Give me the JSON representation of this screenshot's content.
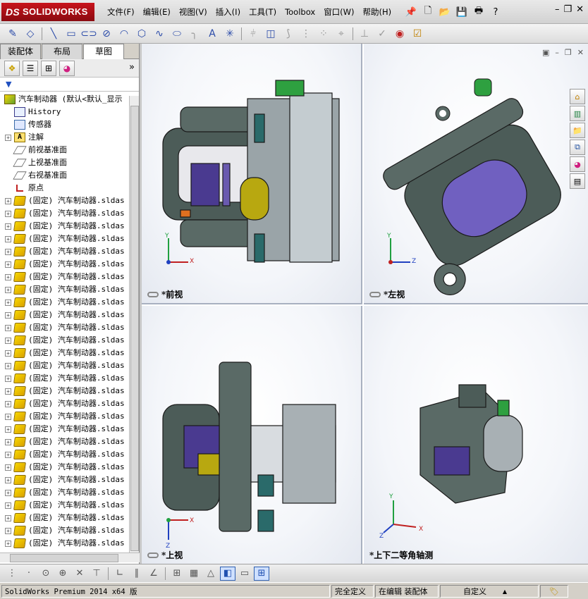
{
  "app": {
    "name": "SOLIDWORKS",
    "logo_mark": "DS"
  },
  "menus": [
    "文件(F)",
    "编辑(E)",
    "视图(V)",
    "插入(I)",
    "工具(T)",
    "Toolbox",
    "窗口(W)",
    "帮助(H)"
  ],
  "left_panel": {
    "tabs": [
      "装配体",
      "布局",
      "草图"
    ],
    "active_tab": "草图",
    "expand_glyph": "»",
    "filter_glyph": "▼",
    "tree": {
      "root": "汽车制动器  (默认<默认_显示",
      "items": [
        {
          "label": "History",
          "icon": "history-icon",
          "expandable": false
        },
        {
          "label": "传感器",
          "icon": "sensor-icon",
          "expandable": false
        },
        {
          "label": "注解",
          "icon": "annotation-icon",
          "expandable": true
        },
        {
          "label": "前视基准面",
          "icon": "plane-icon",
          "expandable": false
        },
        {
          "label": "上视基准面",
          "icon": "plane-icon",
          "expandable": false
        },
        {
          "label": "右视基准面",
          "icon": "plane-icon",
          "expandable": false
        },
        {
          "label": "原点",
          "icon": "origin-icon",
          "expandable": false
        }
      ],
      "component_label": "(固定) 汽车制动器.sldas",
      "component_count": 28
    }
  },
  "viewports": [
    {
      "label": "*前视"
    },
    {
      "label": "*左视"
    },
    {
      "label": "*上视"
    },
    {
      "label": "*上下二等角轴测"
    }
  ],
  "triad_labels": {
    "x": "X",
    "y": "Y",
    "z": "Z"
  },
  "status": {
    "product": "SolidWorks Premium 2014 x64 版",
    "definition": "完全定义",
    "mode": "在编辑 装配体",
    "units": "自定义",
    "units_arrow": "▲"
  },
  "colors": {
    "accent": "#c8141c",
    "selection": "#3060b0"
  }
}
